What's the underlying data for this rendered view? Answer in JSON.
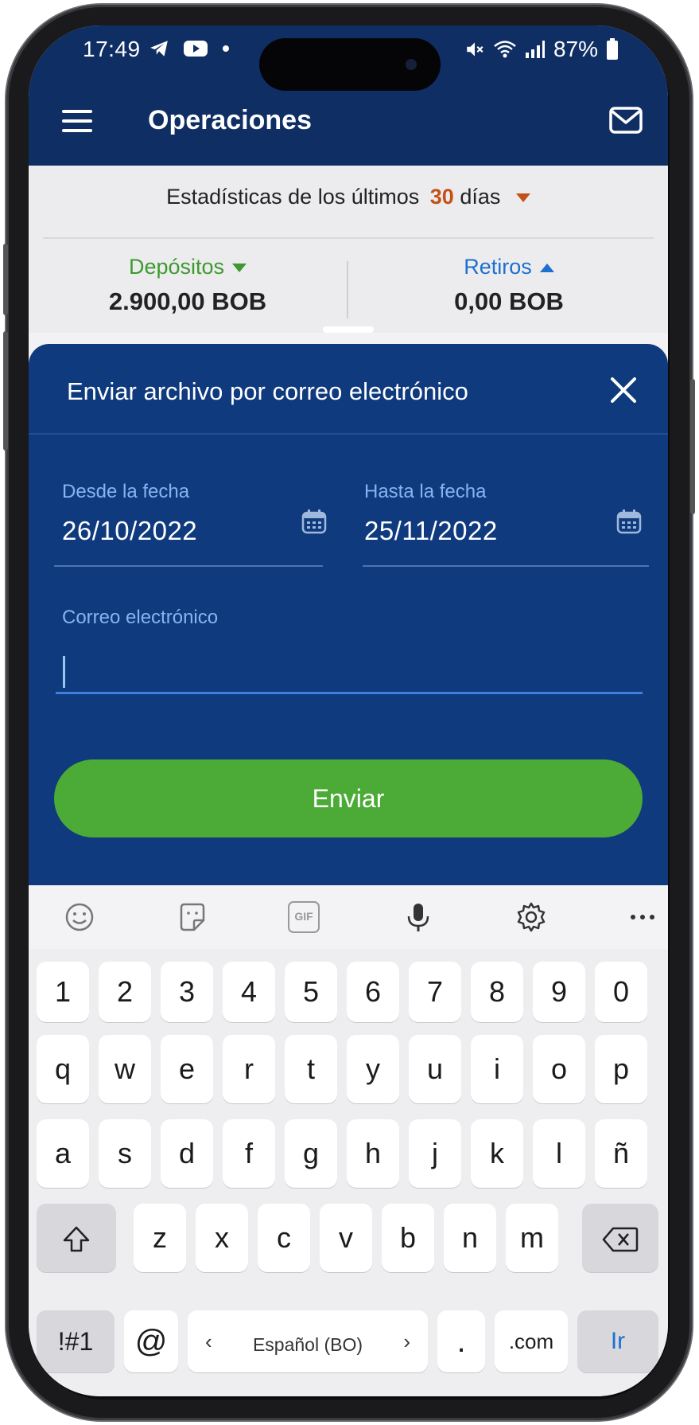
{
  "status_bar": {
    "time": "17:49",
    "battery": "87%",
    "icons": [
      "telegram-icon",
      "youtube-icon",
      "dot-icon",
      "mute-icon",
      "wifi-icon",
      "signal-icon",
      "battery-icon"
    ]
  },
  "header": {
    "title": "Operaciones"
  },
  "stats": {
    "title_prefix": "Estadísticas de los últimos",
    "days_value": "30",
    "title_suffix": "días",
    "deposits_label": "Depósitos",
    "deposits_value": "2.900,00 BOB",
    "withdrawals_label": "Retiros",
    "withdrawals_value": "0,00 BOB"
  },
  "sheet": {
    "title": "Enviar archivo por correo electrónico",
    "from_label": "Desde la fecha",
    "from_value": "26/10/2022",
    "to_label": "Hasta la fecha",
    "to_value": "25/11/2022",
    "email_label": "Correo electrónico",
    "email_value": "",
    "send_label": "Enviar"
  },
  "keyboard": {
    "toolbar": [
      "emoji-icon",
      "sticker-icon",
      "gif-icon",
      "microphone-icon",
      "settings-icon",
      "more-icon"
    ],
    "gif_text": "GIF",
    "row_numbers": [
      "1",
      "2",
      "3",
      "4",
      "5",
      "6",
      "7",
      "8",
      "9",
      "0"
    ],
    "row_top": [
      "q",
      "w",
      "e",
      "r",
      "t",
      "y",
      "u",
      "i",
      "o",
      "p"
    ],
    "row_middle": [
      "a",
      "s",
      "d",
      "f",
      "g",
      "h",
      "j",
      "k",
      "l",
      "ñ"
    ],
    "row_bottom": [
      "z",
      "x",
      "c",
      "v",
      "b",
      "n",
      "m"
    ],
    "symbols_label": "!#1",
    "at_label": "@",
    "language_label": "Español (BO)",
    "period_label": ".",
    "dotcom_label": ".com",
    "go_label": "Ir"
  },
  "colors": {
    "header_bg": "#0f2e63",
    "sheet_bg": "#0f3a7d",
    "send_button": "#4bab36",
    "deposits": "#3d9a2f",
    "withdrawals": "#1e6fd0",
    "days_accent": "#c2521a",
    "go_key": "#1e6fd0"
  }
}
